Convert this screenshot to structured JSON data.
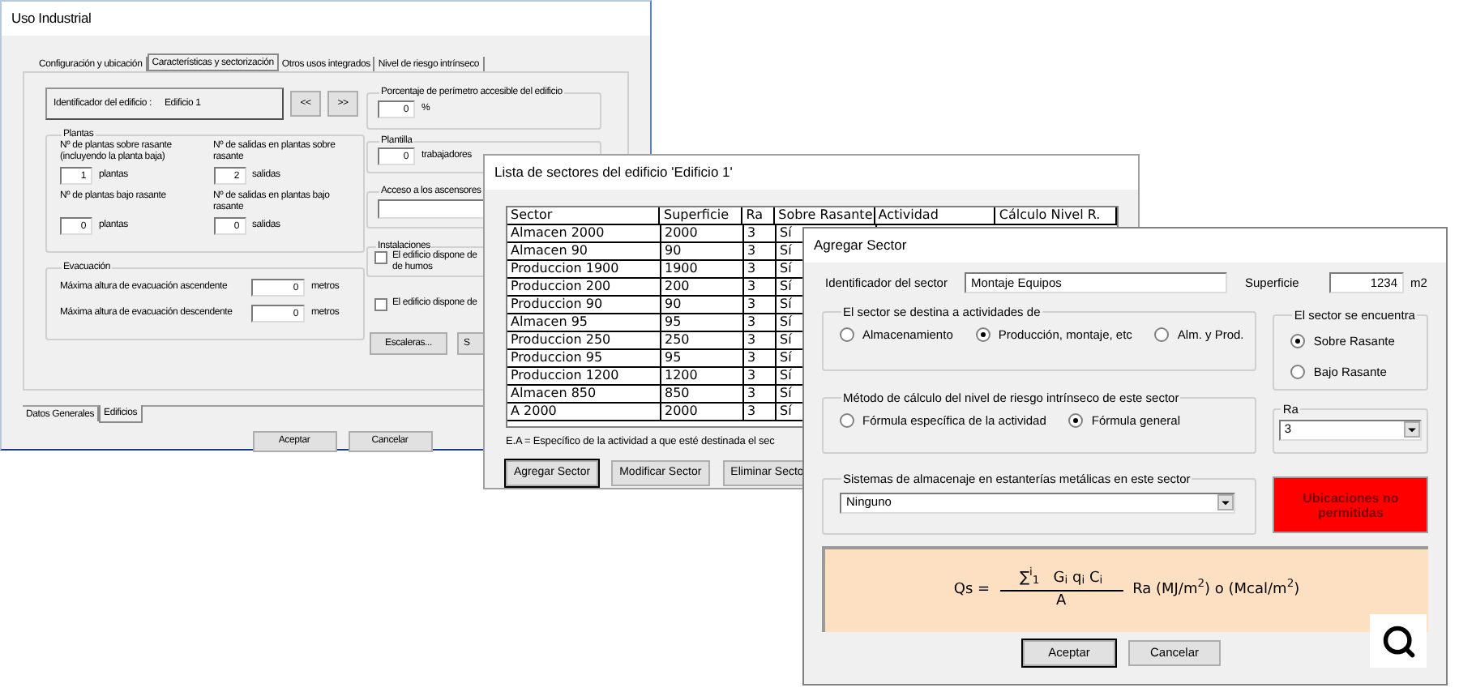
{
  "main_window": {
    "title": "Uso Industrial",
    "tabs": [
      {
        "label": "Configuración y ubicación",
        "selected": false
      },
      {
        "label": "Características y sectorización",
        "selected": true
      },
      {
        "label": "Otros usos integrados",
        "selected": false
      },
      {
        "label": "Nivel de riesgo intrínseco",
        "selected": false
      }
    ],
    "building_id": {
      "label": "Identificador del edificio :",
      "value": "Edificio 1"
    },
    "nav_buttons": [
      "<<",
      ">>"
    ],
    "plantas": {
      "title": "Plantas",
      "fields": [
        {
          "label": "Nº de plantas sobre rasante (incluyendo la planta baja)",
          "value": "1",
          "unit": "plantas"
        },
        {
          "label": "Nº de salidas en plantas sobre rasante",
          "value": "2",
          "unit": "salidas"
        },
        {
          "label": "Nº de plantas bajo rasante",
          "value": "0",
          "unit": "plantas"
        },
        {
          "label": "Nº de salidas en plantas bajo rasante",
          "value": "0",
          "unit": "salidas"
        }
      ]
    },
    "evacuacion": {
      "title": "Evacuación",
      "fields": [
        {
          "label": "Máxima altura de evacuación ascendente",
          "value": "0",
          "unit": "metros"
        },
        {
          "label": "Máxima altura de evacuación descendente",
          "value": "0",
          "unit": "metros"
        }
      ]
    },
    "perimetro": {
      "title": "Porcentaje de perímetro accesible del edificio",
      "value": "0",
      "unit": "%"
    },
    "plantilla": {
      "title": "Plantilla",
      "value": "0",
      "unit": "trabajadores"
    },
    "ascensores": {
      "title": "Acceso a los ascensores"
    },
    "instalaciones": {
      "title": "Instalaciones",
      "check": {
        "lines": [
          "El edificio dispone de",
          "de humos"
        ],
        "checked": false
      }
    },
    "extra_check": {
      "label": "El edificio dispone de",
      "checked": false
    },
    "side_buttons": [
      "Escaleras...",
      "S"
    ],
    "bottom_tabs": [
      {
        "label": "Datos Generales",
        "selected": false
      },
      {
        "label": "Edificios",
        "selected": true
      }
    ],
    "buttons": [
      "Aceptar",
      "Cancelar"
    ]
  },
  "sector_list_window": {
    "title": "Lista de sectores del edificio 'Edificio 1'",
    "columns": [
      "Sector",
      "Superficie",
      "Ra",
      "Sobre Rasante",
      "Actividad",
      "Cálculo Nivel R."
    ],
    "rows": [
      [
        "Almacen 2000",
        "2000",
        "3",
        "Sí"
      ],
      [
        "Almacen 90",
        "90",
        "3",
        "Sí"
      ],
      [
        "Produccion 1900",
        "1900",
        "3",
        "Sí"
      ],
      [
        "Produccion 200",
        "200",
        "3",
        "Sí"
      ],
      [
        "Produccion 90",
        "90",
        "3",
        "Sí"
      ],
      [
        "Almacen 95",
        "95",
        "3",
        "Sí"
      ],
      [
        "Produccion 250",
        "250",
        "3",
        "Sí"
      ],
      [
        "Produccion 95",
        "95",
        "3",
        "Sí"
      ],
      [
        "Produccion 1200",
        "1200",
        "3",
        "Sí"
      ],
      [
        "Almacen 850",
        "850",
        "3",
        "Sí"
      ],
      [
        "A 2000",
        "2000",
        "3",
        "Sí"
      ]
    ],
    "note": "E.A = Específico de la actividad a que esté destinada el sec",
    "buttons": [
      "Agregar Sector",
      "Modificar Sector",
      "Eliminar Secto"
    ]
  },
  "add_sector_window": {
    "title": "Agregar Sector",
    "sector_id": {
      "label": "Identificador del sector",
      "value": "Montaje Equipos"
    },
    "area": {
      "label": "Superficie",
      "value": "1234",
      "unit": "m2"
    },
    "activity": {
      "title": "El sector se destina a actividades de",
      "options": [
        {
          "label": "Almacenamiento",
          "selected": false
        },
        {
          "label": "Producción, montaje, etc",
          "selected": true
        },
        {
          "label": "Alm. y Prod.",
          "selected": false
        }
      ]
    },
    "location": {
      "title": "El sector se encuentra",
      "options": [
        {
          "label": "Sobre Rasante",
          "selected": true
        },
        {
          "label": "Bajo Rasante",
          "selected": false
        }
      ]
    },
    "method": {
      "title": "Método de cálculo del nivel de riesgo intrínseco de este sector",
      "options": [
        {
          "label": "Fórmula específica de la actividad",
          "selected": false
        },
        {
          "label": "Fórmula general",
          "selected": true
        }
      ]
    },
    "ra": {
      "title": "Ra",
      "value": "3"
    },
    "storage": {
      "title": "Sistemas de almacenaje en estanterías metálicas en este sector",
      "value": "Ninguno"
    },
    "warning": "Ubicaciones no permitidas",
    "formula": {
      "lhs": "Qs =",
      "numerator": "∑$^{i}$$_{1}$   G$_{i}$ q$_{i}$ C$_{i}$",
      "denominator": "A",
      "rhs": "Ra (MJ/m$^{2}$) o (Mcal/m$^{2}$)"
    },
    "buttons": [
      "Aceptar",
      "Cancelar"
    ]
  }
}
